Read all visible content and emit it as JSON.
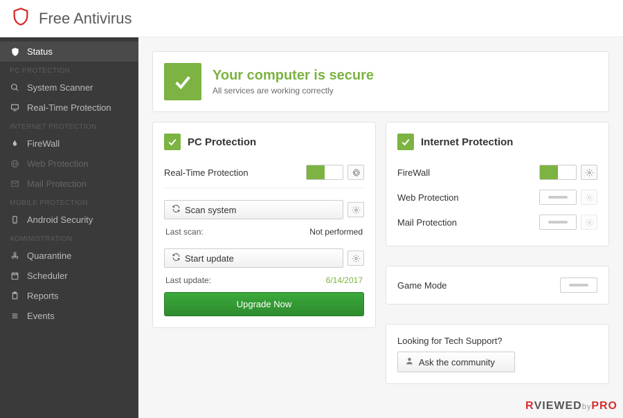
{
  "app": {
    "title": "Free Antivirus"
  },
  "sidebar": {
    "status": "Status",
    "cat1": "PC PROTECTION",
    "system_scanner": "System Scanner",
    "realtime": "Real-Time Protection",
    "cat2": "INTERNET PROTECTION",
    "firewall": "FireWall",
    "web": "Web Protection",
    "mail": "Mail Protection",
    "cat3": "MOBILE PROTECTION",
    "android": "Android Security",
    "cat4": "ADMINISTRATION",
    "quarantine": "Quarantine",
    "scheduler": "Scheduler",
    "reports": "Reports",
    "events": "Events"
  },
  "status": {
    "title": "Your computer is secure",
    "subtitle": "All services are working correctly"
  },
  "pc": {
    "heading": "PC Protection",
    "realtime_label": "Real-Time Protection",
    "scan_btn": "Scan system",
    "last_scan_label": "Last scan:",
    "last_scan_value": "Not performed",
    "update_btn": "Start update",
    "last_update_label": "Last update:",
    "last_update_value": "6/14/2017",
    "upgrade": "Upgrade Now"
  },
  "net": {
    "heading": "Internet Protection",
    "firewall": "FireWall",
    "web": "Web Protection",
    "mail": "Mail Protection",
    "game": "Game Mode"
  },
  "support": {
    "prompt": "Looking for Tech Support?",
    "btn": "Ask the community"
  },
  "watermark": {
    "a": "R",
    "b": "VIEWED",
    "c": "by",
    "d": "PRO"
  }
}
